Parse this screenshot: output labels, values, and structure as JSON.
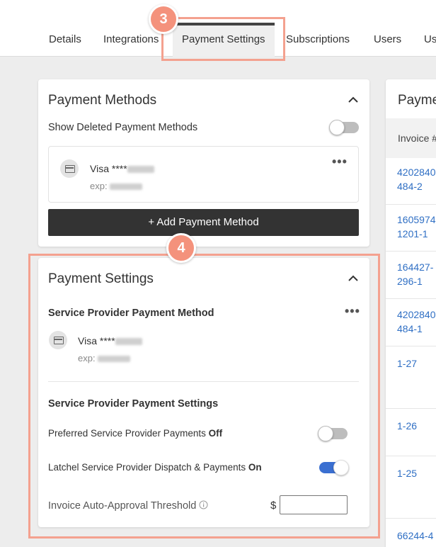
{
  "tabs": [
    {
      "label": "Details"
    },
    {
      "label": "Integrations"
    },
    {
      "label": "Payment Settings"
    },
    {
      "label": "Subscriptions"
    },
    {
      "label": "Users"
    },
    {
      "label": "Us"
    }
  ],
  "steps": {
    "tab_step": "3",
    "section_step": "4"
  },
  "payment_methods": {
    "title": "Payment Methods",
    "show_deleted_label": "Show Deleted Payment Methods",
    "show_deleted_on": false,
    "card": {
      "brand": "Visa ****",
      "exp_label": "exp:",
      "icon": "credit-card-icon"
    },
    "add_button": "+ Add Payment Method"
  },
  "payment_settings": {
    "title": "Payment Settings",
    "sp_method_heading": "Service Provider Payment Method",
    "card": {
      "brand": "Visa ****",
      "exp_label": "exp:",
      "icon": "credit-card-icon"
    },
    "sp_settings_heading": "Service Provider Payment Settings",
    "preferred": {
      "label": "Preferred Service Provider Payments",
      "state": "Off",
      "on": false
    },
    "dispatch": {
      "label": "Latchel Service Provider Dispatch & Payments",
      "state": "On",
      "on": true
    },
    "threshold": {
      "label": "Invoice Auto-Approval Threshold",
      "currency": "$",
      "value": "",
      "icon": "info-icon"
    }
  },
  "invoices": {
    "title": "Payme",
    "column_header": "Invoice #",
    "rows": [
      {
        "line1": "4202840",
        "line2": "484-2"
      },
      {
        "line1": "1605974",
        "line2": "1201-1"
      },
      {
        "line1": "164427-",
        "line2": "296-1"
      },
      {
        "line1": "4202840",
        "line2": "484-1"
      },
      {
        "line1": "1-27",
        "line2": ""
      },
      {
        "line1": "1-26",
        "line2": ""
      },
      {
        "line1": "1-25",
        "line2": ""
      },
      {
        "line1": "66244-4",
        "line2": ""
      }
    ]
  },
  "colors": {
    "highlight": "#f4a18f",
    "step_badge": "#f4927c",
    "toggle_on": "#3a6fd1",
    "button_dark": "#333333",
    "link": "#2f6fc4"
  }
}
